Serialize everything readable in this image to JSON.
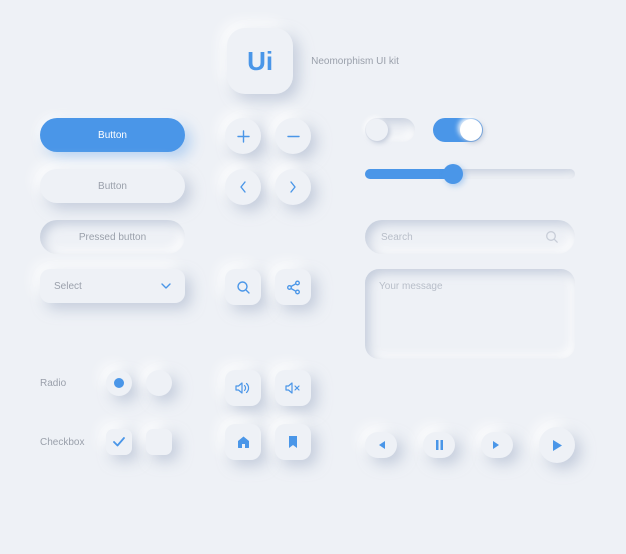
{
  "header": {
    "logo_text": "Ui",
    "label": "Neomorphism UI kit"
  },
  "buttons": {
    "primary": "Button",
    "secondary": "Button",
    "pressed": "Pressed button",
    "select": "Select"
  },
  "toggles": {
    "off": false,
    "on": true
  },
  "slider": {
    "value": 42,
    "min": 0,
    "max": 100
  },
  "search": {
    "placeholder": "Search"
  },
  "message": {
    "placeholder": "Your message"
  },
  "radio": {
    "label": "Radio",
    "options": [
      true,
      false
    ]
  },
  "checkbox": {
    "label": "Checkbox",
    "options": [
      true,
      false
    ]
  },
  "colors": {
    "accent": "#4a96e8",
    "bg": "#eef1f6",
    "muted": "#9aa0ab"
  }
}
